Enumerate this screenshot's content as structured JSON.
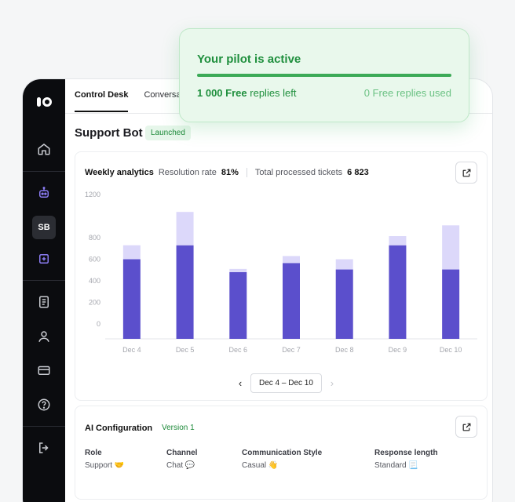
{
  "tabs": [
    {
      "label": "Control Desk",
      "active": true
    },
    {
      "label": "Conversat",
      "active": false
    }
  ],
  "page": {
    "title": "Support Bot",
    "status": "Launched"
  },
  "sidebar": {
    "badge": "SB"
  },
  "analytics": {
    "title": "Weekly analytics",
    "resolution_label": "Resolution rate",
    "resolution_value": "81%",
    "tickets_label": "Total processed tickets",
    "tickets_value": "6 823",
    "range": "Dec 4 – Dec 10",
    "prev": "‹",
    "next": "›"
  },
  "chart_data": {
    "type": "bar",
    "stacked": true,
    "categories": [
      "Dec 4",
      "Dec 5",
      "Dec 6",
      "Dec 7",
      "Dec 8",
      "Dec 9",
      "Dec 10"
    ],
    "series": [
      {
        "values": [
          600,
          730,
          480,
          565,
          505,
          730,
          505
        ],
        "color": "#5b4fcc"
      },
      {
        "values": [
          130,
          310,
          30,
          65,
          95,
          85,
          410
        ],
        "color": "#dcd8fa"
      }
    ],
    "yticks": [
      1200,
      800,
      600,
      400,
      200,
      0
    ],
    "ylim": [
      -140,
      1260
    ],
    "grid": false
  },
  "config": {
    "title": "AI Configuration",
    "version": "Version 1",
    "columns": [
      {
        "label": "Role",
        "value": "Support 🤝"
      },
      {
        "label": "Channel",
        "value": "Chat 💬"
      },
      {
        "label": "Communication Style",
        "value": "Casual 👋"
      },
      {
        "label": "Response length",
        "value": "Standard 📃"
      }
    ]
  },
  "pilot": {
    "title": "Your pilot is active",
    "left_count": "1 000",
    "left_label": "Free",
    "left_suffix": "replies left",
    "used": "0 Free replies used"
  },
  "colors": {
    "accent": "#5b4fcc",
    "accent_light": "#dcd8fa",
    "success": "#1f8f3d"
  }
}
